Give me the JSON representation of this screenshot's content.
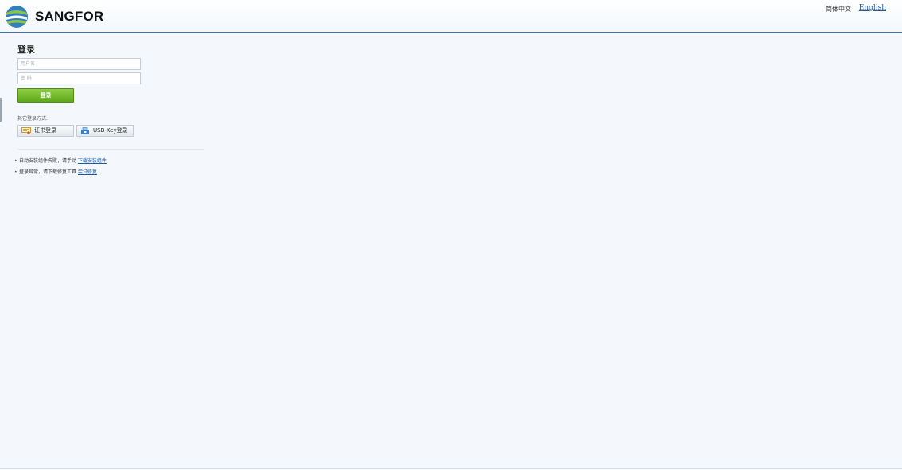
{
  "header": {
    "brand": "SANGFOR",
    "lang_chinese": "简体中文",
    "lang_english": "English"
  },
  "login": {
    "title": "登录",
    "username_placeholder": "用户名",
    "password_placeholder": "密 码",
    "submit_label": "登录"
  },
  "other_methods": {
    "label": "其它登录方式:",
    "cert_login": "证书登录",
    "usbkey_login": "USB-Key登录"
  },
  "tips": [
    {
      "text": "自动安装组件失败，请手动 ",
      "link": "下载安装组件"
    },
    {
      "text": "登录异常，请下载修复工具 ",
      "link": "尝试修复"
    }
  ],
  "colors": {
    "accent": "#3a73b8",
    "login_button": "#6cb52a",
    "link": "#1b58a8",
    "background": "#f4f8fc"
  }
}
